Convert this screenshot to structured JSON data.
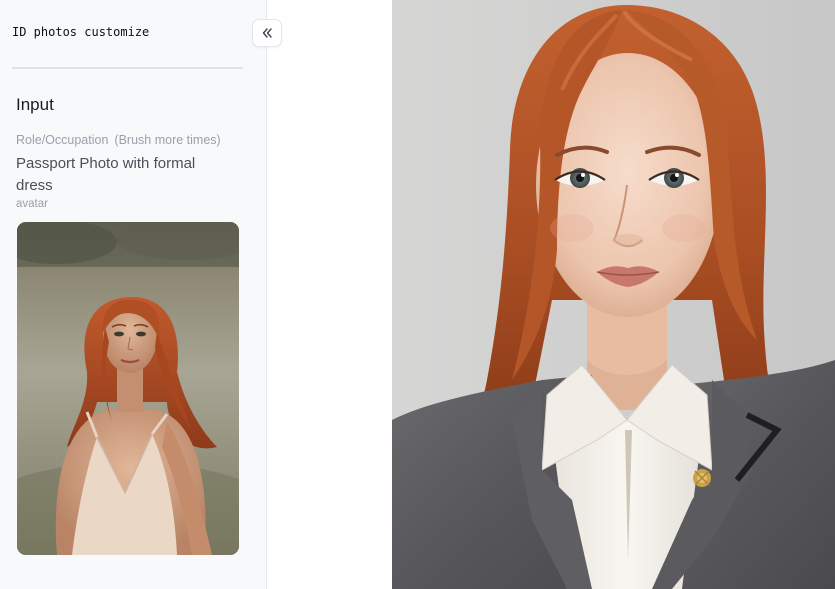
{
  "app": {
    "title": "ID photos customize"
  },
  "sidebar": {
    "collapse_icon": "double-chevron-left-icon",
    "section_title": "Input",
    "role_field": {
      "label": "Role/Occupation",
      "hint": "(Brush more times)",
      "value": "Passport Photo with formal dress"
    },
    "avatar_field": {
      "label": "avatar"
    }
  },
  "colors": {
    "sidebar_bg": "#f8f9fb",
    "label_gray": "#9aa0aa",
    "heading": "#1b1c1f",
    "hair": "#b3582b",
    "suit": "#5c5c60",
    "shirt": "#f3f0ea",
    "backdrop": "#cfcfcf"
  }
}
